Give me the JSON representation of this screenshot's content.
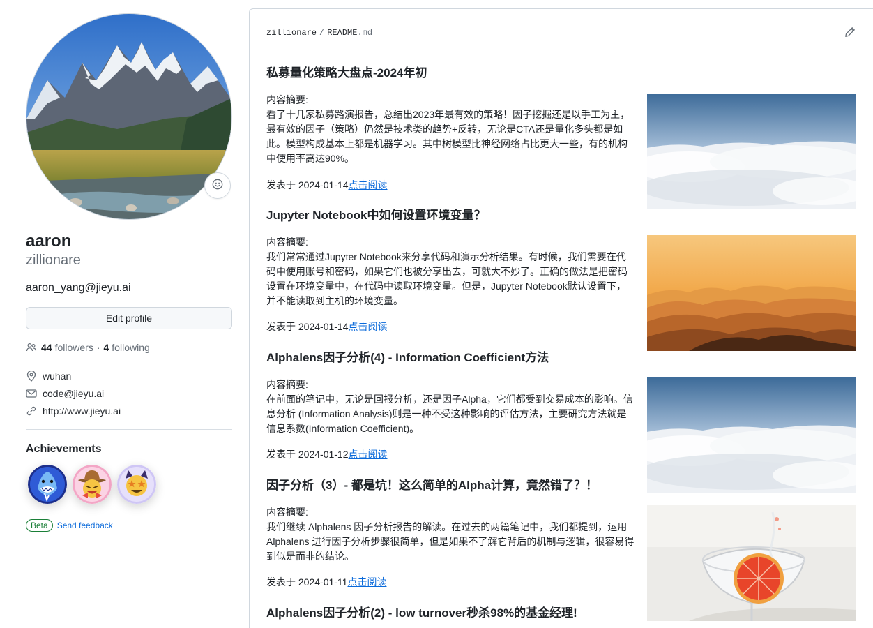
{
  "profile": {
    "name": "aaron",
    "login": "zillionare",
    "bio": "aaron_yang@jieyu.ai",
    "edit_label": "Edit profile",
    "followers_count": "44",
    "followers_label": "followers",
    "separator": "·",
    "following_count": "4",
    "following_label": "following",
    "location": "wuhan",
    "email": "code@jieyu.ai",
    "website": "http://www.jieyu.ai",
    "icons": {
      "followers": "people-icon",
      "location": "location-pin-icon",
      "email": "mail-icon",
      "website": "link-icon",
      "status": "smiley-icon"
    }
  },
  "achievements": {
    "title": "Achievements",
    "badges": [
      "shark-badge",
      "cowboy-badge",
      "star-struck-cat-badge"
    ],
    "beta_label": "Beta",
    "feedback_label": "Send feedback"
  },
  "readme": {
    "owner": "zillionare",
    "separator": "/",
    "file_base": "README",
    "file_ext": ".md",
    "edit_icon": "pencil-icon",
    "articles": [
      {
        "title": "私募量化策略大盘点-2024年初",
        "summary_label": "内容摘要:",
        "summary": "看了十几家私募路演报告，总结出2023年最有效的策略！因子挖掘还是以手工为主，最有效的因子（策略）仍然是技术类的趋势+反转，无论是CTA还是量化多头都是如此。模型构成基本上都是机器学习。其中树模型比神经网络占比更大一些，有的机构中使用率高达90%。",
        "published_prefix": "发表于 2024-01-14",
        "read_label": "点击阅读",
        "image": "sea-of-clouds-image"
      },
      {
        "title": "Jupyter Notebook中如何设置环境变量？",
        "summary_label": "内容摘要:",
        "summary": "我们常常通过Jupyter Notebook来分享代码和演示分析结果。有时候，我们需要在代码中使用账号和密码，如果它们也被分享出去，可就大不妙了。正确的做法是把密码设置在环境变量中，在代码中读取环境变量。但是，Jupyter Notebook默认设置下，并不能读取到主机的环境变量。",
        "published_prefix": "发表于 2024-01-14",
        "read_label": "点击阅读",
        "image": "orange-mountains-image"
      },
      {
        "title": "Alphalens因子分析(4) - Information Coefficient方法",
        "summary_label": "内容摘要:",
        "summary": "在前面的笔记中，无论是回报分析，还是因子Alpha，它们都受到交易成本的影响。信息分析 (Information Analysis)则是一种不受这种影响的评估方法，主要研究方法就是信息系数(Information Coefficient)。",
        "published_prefix": "发表于 2024-01-12",
        "read_label": "点击阅读",
        "image": "sea-of-clouds-image"
      },
      {
        "title": "因子分析（3）- 都是坑！这么简单的Alpha计算，竟然错了？！",
        "summary_label": "内容摘要:",
        "summary": "我们继续 Alphalens 因子分析报告的解读。在过去的两篇笔记中，我们都提到，运用 Alphalens 进行因子分析步骤很简单，但是如果不了解它背后的机制与逻辑，很容易得到似是而非的结论。",
        "published_prefix": "发表于 2024-01-11",
        "read_label": "点击阅读",
        "image": "grapefruit-cocktail-image"
      },
      {
        "title": "Alphalens因子分析(2) - low turnover秒杀98%的基金经理!"
      }
    ]
  }
}
